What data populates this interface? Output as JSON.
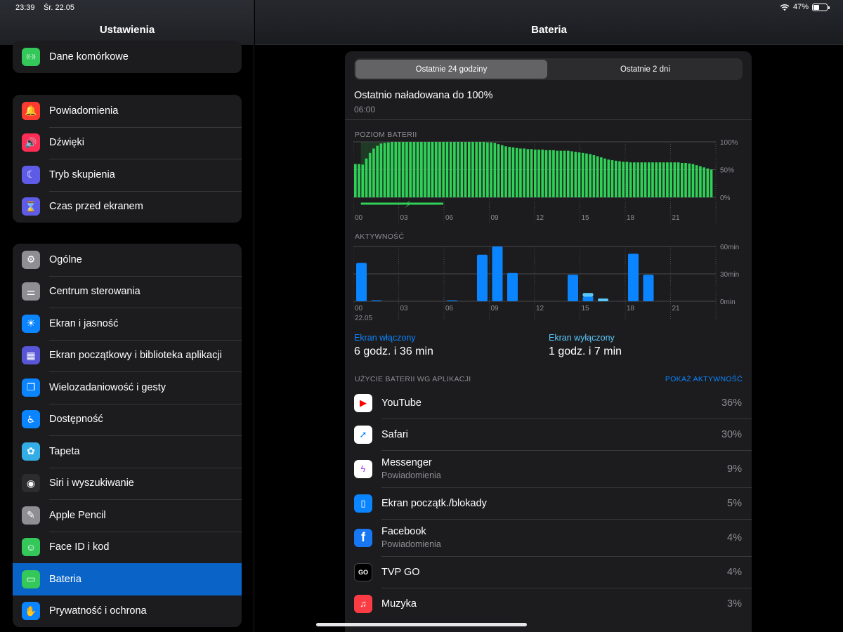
{
  "status": {
    "time": "23:39",
    "date": "Śr. 22.05",
    "battery": "47%"
  },
  "sidebar": {
    "title": "Ustawienia",
    "group1": [
      {
        "label": "Dane komórkowe",
        "icon": "antenna-icon",
        "color": "#34c759"
      }
    ],
    "group2": [
      {
        "label": "Powiadomienia",
        "icon": "notification-bell-icon",
        "color": "#ff3b30"
      },
      {
        "label": "Dźwięki",
        "icon": "speaker-icon",
        "color": "#ff2d55"
      },
      {
        "label": "Tryb skupienia",
        "icon": "moon-icon",
        "color": "#5e5ce6"
      },
      {
        "label": "Czas przed ekranem",
        "icon": "hourglass-icon",
        "color": "#5e5ce6"
      }
    ],
    "group3": [
      {
        "label": "Ogólne",
        "icon": "gear-icon",
        "color": "#8e8e93"
      },
      {
        "label": "Centrum sterowania",
        "icon": "toggles-icon",
        "color": "#8e8e93"
      },
      {
        "label": "Ekran i jasność",
        "icon": "sun-icon",
        "color": "#0a84ff"
      },
      {
        "label": "Ekran początkowy i biblioteka aplikacji",
        "icon": "home-grid-icon",
        "color": "#5856d6"
      },
      {
        "label": "Wielozadaniowość i gesty",
        "icon": "multitasking-icon",
        "color": "#0a84ff"
      },
      {
        "label": "Dostępność",
        "icon": "accessibility-icon",
        "color": "#0a84ff"
      },
      {
        "label": "Tapeta",
        "icon": "flower-icon",
        "color": "#32ade6"
      },
      {
        "label": "Siri i wyszukiwanie",
        "icon": "siri-icon",
        "color": "#2c2c2e"
      },
      {
        "label": "Apple Pencil",
        "icon": "pencil-icon",
        "color": "#8e8e93"
      },
      {
        "label": "Face ID i kod",
        "icon": "face-id-icon",
        "color": "#34c759"
      },
      {
        "label": "Bateria",
        "icon": "battery-icon",
        "color": "#34c759",
        "selected": true
      },
      {
        "label": "Prywatność i ochrona",
        "icon": "hand-icon",
        "color": "#0a84ff"
      }
    ]
  },
  "main": {
    "title": "Bateria",
    "segments": {
      "active": "Ostatnie 24 godziny",
      "inactive": "Ostatnie 2 dni"
    },
    "last_charged": {
      "title": "Ostatnio naładowana do 100%",
      "time": "06:00"
    },
    "level_label": "POZIOM BATERII",
    "activity_label": "AKTYWNOŚĆ",
    "stats": {
      "on_label": "Ekran włączony",
      "on_value": "6 godz. i 36 min",
      "off_label": "Ekran wyłączony",
      "off_value": "1 godz. i 7 min"
    },
    "usage_header": "UŻYCIE BATERII WG APLIKACJI",
    "usage_action": "POKAŻ AKTYWNOŚĆ",
    "apps": [
      {
        "name": "YouTube",
        "sub": "",
        "pct": "36%",
        "icon": "youtube-icon",
        "color": "#ffffff"
      },
      {
        "name": "Safari",
        "sub": "",
        "pct": "30%",
        "icon": "safari-compass-icon",
        "color": "#ffffff"
      },
      {
        "name": "Messenger",
        "sub": "Powiadomienia",
        "pct": "9%",
        "icon": "messenger-icon",
        "color": "#ffffff"
      },
      {
        "name": "Ekran początk./blokady",
        "sub": "",
        "pct": "5%",
        "icon": "lock-screen-icon",
        "color": "#0a84ff"
      },
      {
        "name": "Facebook",
        "sub": "Powiadomienia",
        "pct": "4%",
        "icon": "facebook-icon",
        "color": "#1877f2"
      },
      {
        "name": "TVP GO",
        "sub": "",
        "pct": "4%",
        "icon": "tvp-go-icon",
        "color": "#000000"
      },
      {
        "name": "Muzyka",
        "sub": "",
        "pct": "3%",
        "icon": "music-note-icon",
        "color": "#fc3c44"
      }
    ]
  },
  "chart_data": [
    {
      "type": "bar",
      "title": "POZIOM BATERII",
      "x_ticks": [
        "00",
        "03",
        "06",
        "09",
        "12",
        "15",
        "18",
        "21"
      ],
      "y_ticks": [
        "100%",
        "50%",
        "0%"
      ],
      "ylim": [
        0,
        100
      ],
      "charging_span_hours": [
        0.5,
        6
      ],
      "series": [
        {
          "values": [
            60,
            60,
            59,
            70,
            80,
            88,
            93,
            97,
            98,
            99,
            100,
            100,
            100,
            100,
            100,
            100,
            100,
            100,
            100,
            100,
            100,
            100,
            100,
            100,
            100,
            100,
            100,
            100,
            100,
            100,
            100,
            100,
            100,
            100,
            100,
            100,
            99,
            99,
            98,
            96,
            94,
            92,
            91,
            90,
            89,
            88,
            88,
            87,
            87,
            86,
            86,
            86,
            85,
            85,
            85,
            84,
            84,
            84,
            84,
            83,
            82,
            81,
            80,
            79,
            78,
            76,
            74,
            72,
            70,
            68,
            67,
            66,
            65,
            64,
            64,
            63,
            63,
            63,
            63,
            63,
            63,
            63,
            63,
            63,
            63,
            63,
            63,
            63,
            63,
            62,
            62,
            61,
            60,
            58,
            56,
            54,
            52,
            50
          ]
        }
      ]
    },
    {
      "type": "bar",
      "title": "AKTYWNOŚĆ",
      "x_ticks": [
        "00",
        "03",
        "06",
        "09",
        "12",
        "15",
        "18",
        "21"
      ],
      "x_date": "22.05",
      "y_ticks": [
        "60min",
        "30min",
        "0min"
      ],
      "ylim": [
        0,
        60
      ],
      "series": [
        {
          "name": "Ekran włączony",
          "values": [
            42,
            1,
            0,
            0,
            0,
            0,
            1,
            0,
            51,
            60,
            31,
            0,
            0,
            0,
            29,
            5,
            0,
            0,
            52,
            29,
            0,
            0,
            0,
            0,
            0,
            0,
            0,
            0,
            0,
            0,
            0,
            0,
            0,
            0,
            0,
            0
          ]
        },
        {
          "name": "Ekran wyłączony",
          "values": [
            0,
            0,
            0,
            0,
            0,
            0,
            0,
            0,
            0,
            0,
            0,
            0,
            0,
            0,
            0,
            4,
            3,
            0,
            0,
            0,
            0,
            0,
            0,
            0,
            0,
            0,
            0,
            0,
            0,
            0,
            0,
            0,
            0,
            0,
            0,
            0
          ]
        }
      ]
    }
  ]
}
